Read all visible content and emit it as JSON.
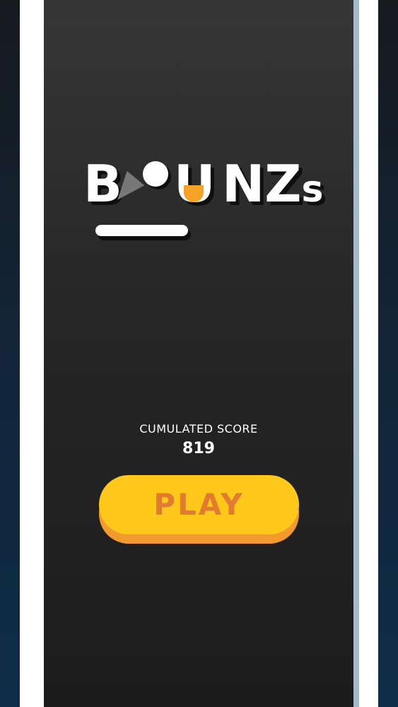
{
  "logo": {
    "letter_b": "B",
    "letter_u": "U",
    "letters_nz": "NZ",
    "letter_s": "s",
    "ball_icon": "ball-icon"
  },
  "score": {
    "label": "CUMULATED SCORE",
    "value": "819"
  },
  "play_button": {
    "label": "PLAY"
  },
  "colors": {
    "accent_yellow": "#ffc81b",
    "accent_orange": "#f29a2e",
    "play_text": "#e27a2f",
    "logo_orange": "#f5a227",
    "playfield": "#262626",
    "walls": "#ffffff"
  }
}
